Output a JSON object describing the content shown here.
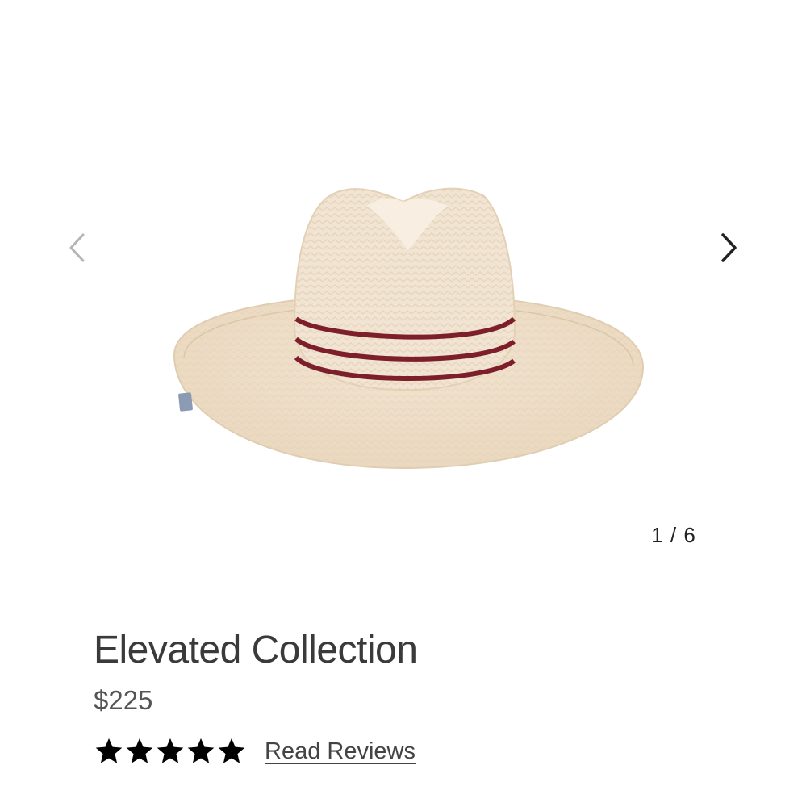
{
  "product": {
    "title": "Elevated Collection",
    "price": "$225",
    "rating_value": 5,
    "rating_max": 5,
    "reviews_link": "Read Reviews"
  },
  "gallery": {
    "current": "1",
    "separator": "/",
    "total": "6",
    "image_icon": "straw-fedora-hat",
    "prev_icon": "chevron-left-icon",
    "next_icon": "chevron-right-icon"
  },
  "colors": {
    "straw": "#efe1cd",
    "band": "#7d1f2b",
    "text": "#3a3a3a",
    "arrow_disabled": "#b5b5b5",
    "arrow_active": "#222222"
  }
}
